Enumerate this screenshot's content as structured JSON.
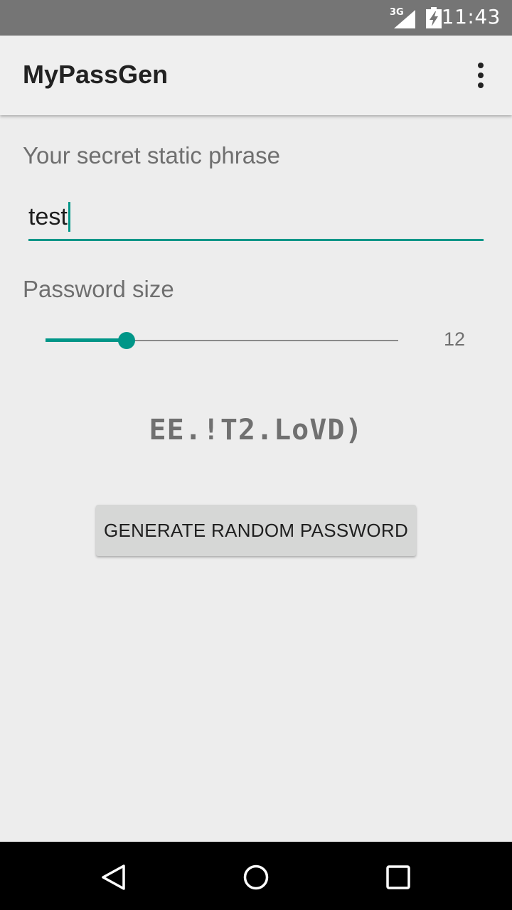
{
  "status_bar": {
    "network": "3G",
    "time": "11:43",
    "icons": [
      "signal-icon",
      "battery-charging-icon"
    ]
  },
  "app_bar": {
    "title": "MyPassGen",
    "menu_icon": "more-vert-icon"
  },
  "form": {
    "phrase_label": "Your secret static phrase",
    "phrase_value": "test",
    "size_label": "Password size",
    "size_value": "12",
    "slider_level": 0.23
  },
  "generated_password": "EE.!T2.LoVD)",
  "generate_button_label": "GENERATE RANDOM PASSWORD",
  "nav_bar": {
    "icons": [
      "back-icon",
      "home-icon",
      "recents-icon"
    ]
  },
  "colors": {
    "accent": "#009688",
    "status_bar": "#757575",
    "app_bar": "#efefef",
    "background": "#ededed",
    "button": "#d6d7d6",
    "nav_bar": "#000000"
  }
}
